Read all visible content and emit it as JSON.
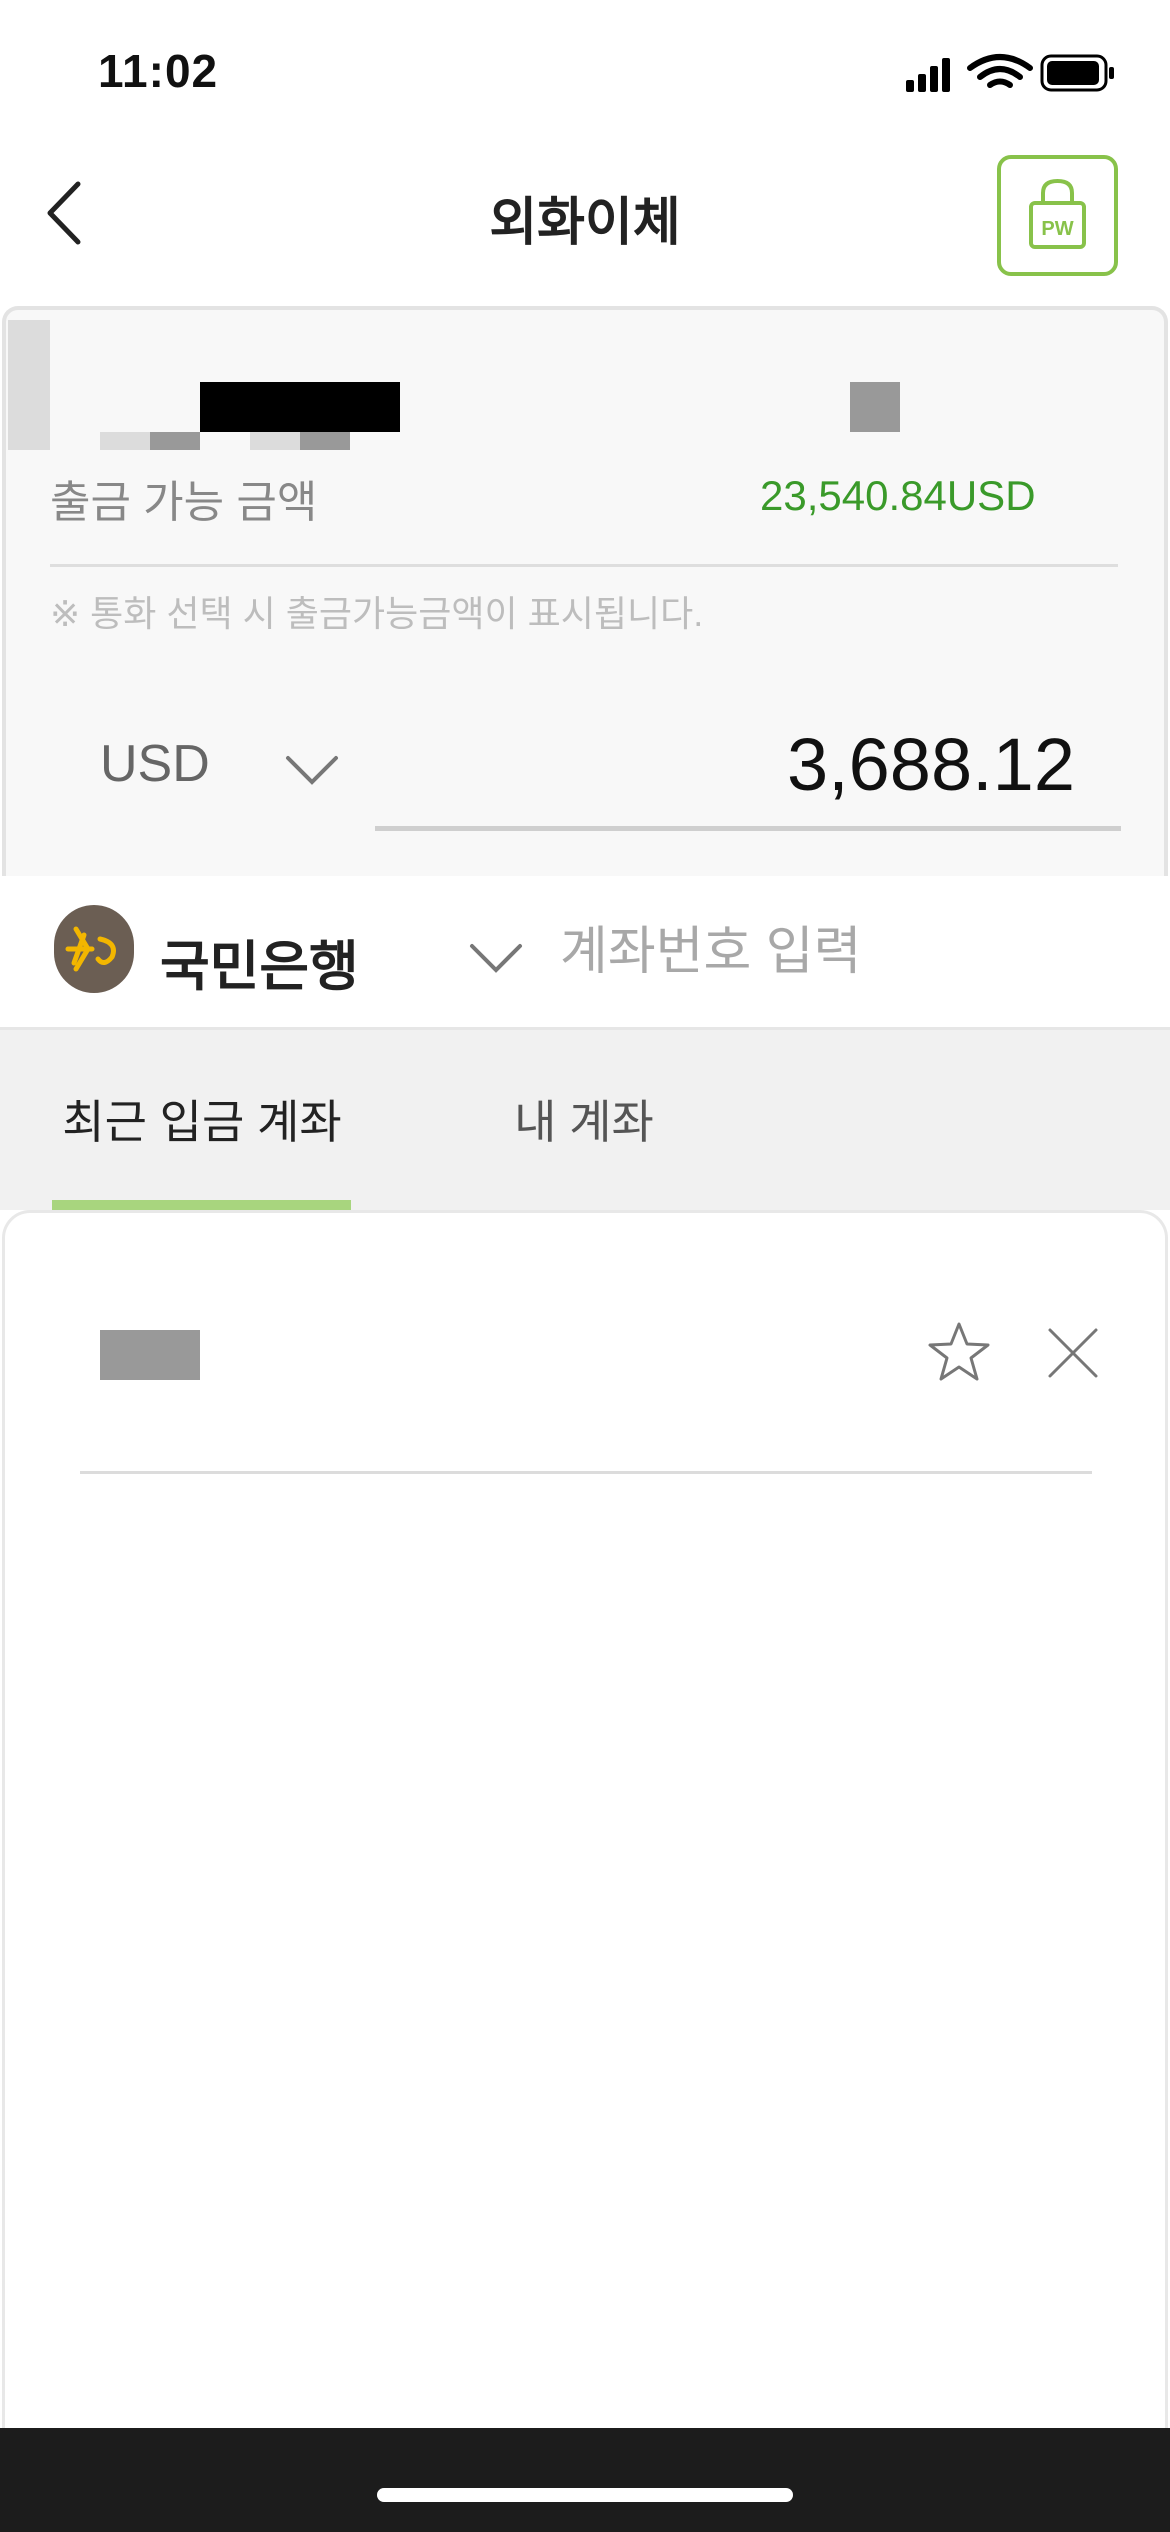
{
  "status_bar": {
    "time": "11:02",
    "icons": [
      "cellular-signal-icon",
      "wifi-icon",
      "battery-icon"
    ]
  },
  "nav": {
    "title": "외화이체",
    "back_icon": "chevron-left-icon",
    "pw_button_label": "PW"
  },
  "account": {
    "available_label": "출금 가능 금액",
    "available_value": "23,540.84USD",
    "notice": "※ 통화 선택 시 출금가능금액이 표시됩니다.",
    "currency": "USD",
    "amount": "3,688.12"
  },
  "bank": {
    "name": "국민은행",
    "account_placeholder": "계좌번호 입력"
  },
  "tabs": [
    {
      "label": "최근 입금 계좌",
      "active": true
    },
    {
      "label": "내 계좌",
      "active": false
    }
  ],
  "colors": {
    "accent_green": "#88c24a",
    "value_green": "#3a9a2a",
    "active_tab_bar": "#a8d57e",
    "kb_logo_bg": "#6b5e53",
    "kb_logo_mark": "#f2b600"
  }
}
